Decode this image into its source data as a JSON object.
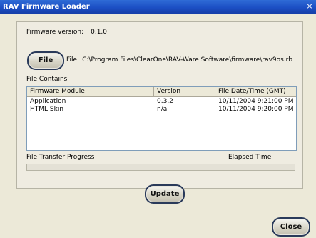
{
  "window": {
    "title": "RAV Firmware Loader",
    "close_glyph": "×"
  },
  "firmware": {
    "label": "Firmware version:",
    "value": "0.1.0"
  },
  "file": {
    "button_label": "File",
    "path_label": "File:",
    "path": "C:\\Program Files\\ClearOne\\RAV-Ware Software\\firmware\\rav9os.rb"
  },
  "contains": {
    "label": "File Contains",
    "columns": [
      "Firmware Module",
      "Version",
      "File Date/Time (GMT)"
    ],
    "rows": [
      [
        "Application",
        "0.3.2",
        "10/11/2004 9:21:00 PM"
      ],
      [
        "HTML Skin",
        "n/a",
        "10/11/2004 9:20:00 PM"
      ]
    ]
  },
  "progress": {
    "label": "File Transfer Progress",
    "elapsed_label": "Elapsed Time",
    "value": 0
  },
  "buttons": {
    "update": "Update",
    "close": "Close"
  },
  "colors": {
    "titlebar": "#1c4fc4",
    "background": "#ece9d8"
  }
}
